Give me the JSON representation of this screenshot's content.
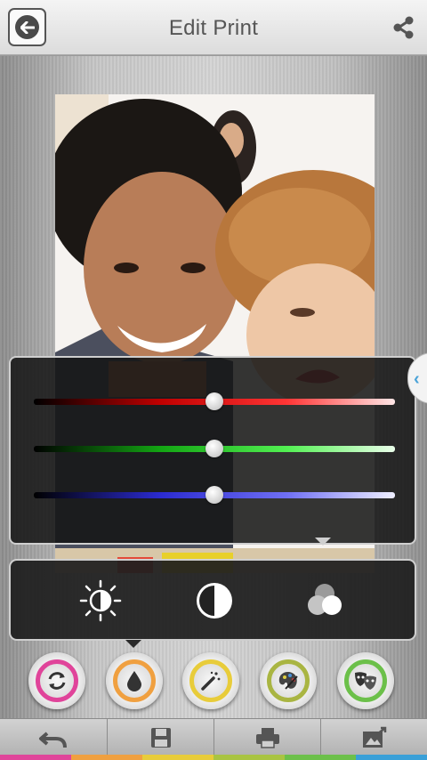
{
  "header": {
    "title": "Edit Print",
    "back_icon": "back-arrow-icon",
    "share_icon": "share-icon"
  },
  "rgb_sliders": [
    {
      "channel": "red",
      "value": 0.5,
      "color": "#ff3535"
    },
    {
      "channel": "green",
      "value": 0.5,
      "color": "#52f052"
    },
    {
      "channel": "blue",
      "value": 0.5,
      "color": "#6f6ff4"
    }
  ],
  "tools": [
    {
      "name": "brightness",
      "icon": "brightness-icon"
    },
    {
      "name": "contrast",
      "icon": "contrast-icon"
    },
    {
      "name": "color-balance",
      "icon": "color-balance-icon"
    }
  ],
  "ring_buttons": [
    {
      "icon": "rotate-icon",
      "color": "#e0449a"
    },
    {
      "icon": "drop-icon",
      "color": "#f0a040"
    },
    {
      "icon": "magic-wand-icon",
      "color": "#e8cc3a"
    },
    {
      "icon": "palette-icon",
      "color": "#a9b542"
    },
    {
      "icon": "masks-icon",
      "color": "#6cc04a"
    }
  ],
  "bottom_bar": [
    {
      "icon": "undo-icon"
    },
    {
      "icon": "save-icon"
    },
    {
      "icon": "print-icon"
    },
    {
      "icon": "export-icon"
    }
  ],
  "color_strip": [
    "#e0449a",
    "#f0a040",
    "#e8cc3a",
    "#a9c442",
    "#6cc04a",
    "#3aa0d8"
  ]
}
